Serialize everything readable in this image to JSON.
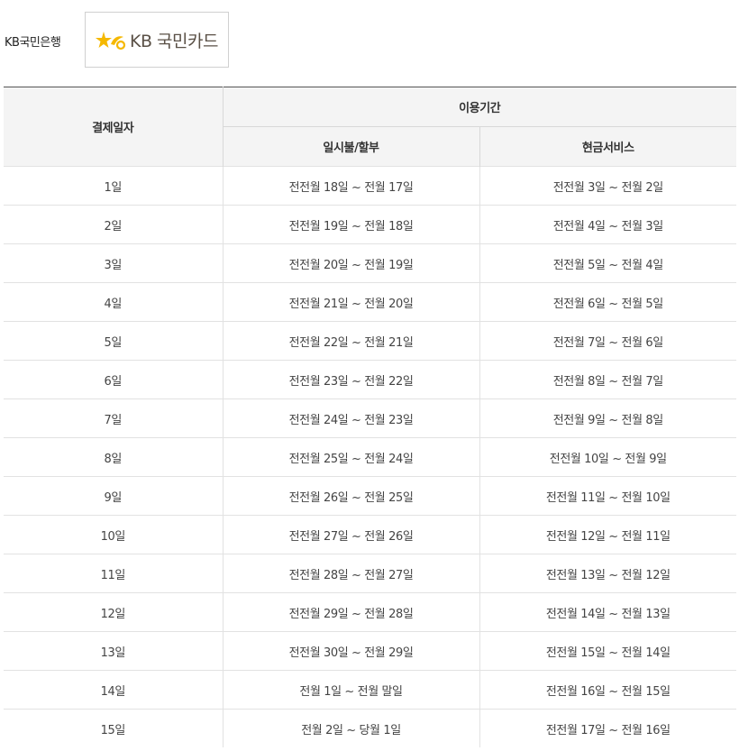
{
  "bank_label": "KB국민은행",
  "logo": {
    "text": "KB 국민카드",
    "mark_color": "#f5b800",
    "text_color": "#5a5046"
  },
  "table": {
    "header_payment_day": "결제일자",
    "header_period": "이용기간",
    "header_lumpsum": "일시불/할부",
    "header_cash": "현금서비스",
    "rows": [
      {
        "day": "1일",
        "lumpsum": "전전월 18일 ~ 전월 17일",
        "cash": "전전월 3일 ~ 전월 2일"
      },
      {
        "day": "2일",
        "lumpsum": "전전월 19일 ~ 전월 18일",
        "cash": "전전월 4일 ~ 전월 3일"
      },
      {
        "day": "3일",
        "lumpsum": "전전월 20일 ~ 전월 19일",
        "cash": "전전월 5일 ~ 전월 4일"
      },
      {
        "day": "4일",
        "lumpsum": "전전월 21일 ~ 전월 20일",
        "cash": "전전월 6일 ~ 전월 5일"
      },
      {
        "day": "5일",
        "lumpsum": "전전월 22일 ~ 전월 21일",
        "cash": "전전월 7일 ~ 전월 6일"
      },
      {
        "day": "6일",
        "lumpsum": "전전월 23일 ~ 전월 22일",
        "cash": "전전월 8일 ~ 전월 7일"
      },
      {
        "day": "7일",
        "lumpsum": "전전월 24일 ~ 전월 23일",
        "cash": "전전월 9일 ~ 전월 8일"
      },
      {
        "day": "8일",
        "lumpsum": "전전월 25일 ~ 전월 24일",
        "cash": "전전월 10일 ~ 전월 9일"
      },
      {
        "day": "9일",
        "lumpsum": "전전월 26일 ~ 전월 25일",
        "cash": "전전월 11일 ~ 전월 10일"
      },
      {
        "day": "10일",
        "lumpsum": "전전월 27일 ~ 전월 26일",
        "cash": "전전월 12일 ~ 전월 11일"
      },
      {
        "day": "11일",
        "lumpsum": "전전월 28일 ~ 전월 27일",
        "cash": "전전월 13일 ~ 전월 12일"
      },
      {
        "day": "12일",
        "lumpsum": "전전월 29일 ~ 전월 28일",
        "cash": "전전월 14일 ~ 전월 13일"
      },
      {
        "day": "13일",
        "lumpsum": "전전월 30일 ~ 전월 29일",
        "cash": "전전월 15일 ~ 전월 14일"
      },
      {
        "day": "14일",
        "lumpsum": "전월 1일 ~ 전월 말일",
        "cash": "전전월 16일 ~ 전월 15일"
      },
      {
        "day": "15일",
        "lumpsum": "전월 2일 ~ 당월 1일",
        "cash": "전전월 17일 ~ 전월 16일"
      }
    ]
  }
}
